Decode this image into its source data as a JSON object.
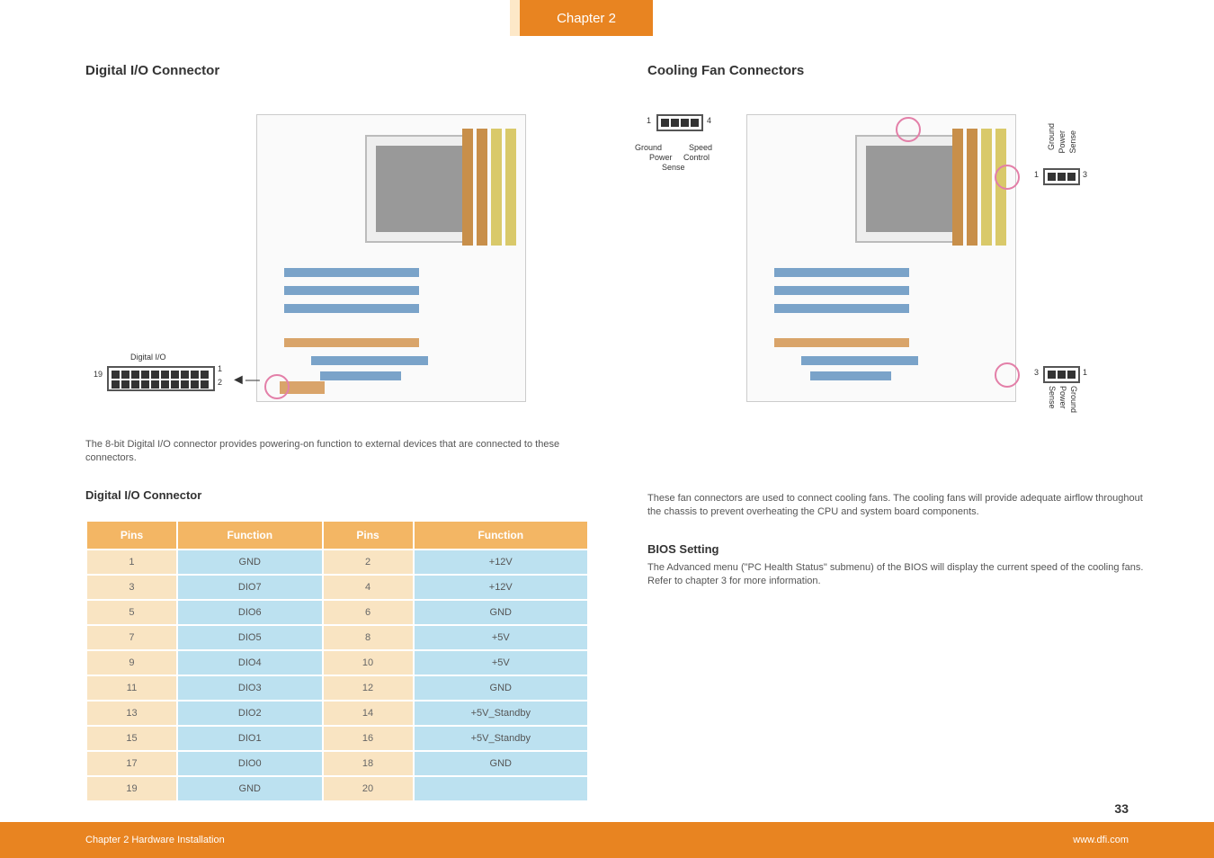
{
  "chapter_tab": "Chapter 2",
  "page_num": "33",
  "footer": {
    "left": "Chapter 2 Hardware Installation",
    "right": "www.dfi.com"
  },
  "left": {
    "heading": "Digital I/O Connector",
    "conn_label": "Digital I/O",
    "pin19": "19",
    "pin1": "1",
    "pin2": "2",
    "desc": "The 8-bit Digital I/O connector provides powering-on function to external devices that are connected to these connectors.",
    "subhead": "Digital I/O Connector",
    "table": {
      "h1": "Pins",
      "h2": "Function",
      "h3": "Pins",
      "h4": "Function",
      "rows": [
        {
          "p1": "1",
          "f1": "GND",
          "p2": "2",
          "f2": "+12V"
        },
        {
          "p1": "3",
          "f1": "DIO7",
          "p2": "4",
          "f2": "+12V"
        },
        {
          "p1": "5",
          "f1": "DIO6",
          "p2": "6",
          "f2": "GND"
        },
        {
          "p1": "7",
          "f1": "DIO5",
          "p2": "8",
          "f2": "+5V"
        },
        {
          "p1": "9",
          "f1": "DIO4",
          "p2": "10",
          "f2": "+5V"
        },
        {
          "p1": "11",
          "f1": "DIO3",
          "p2": "12",
          "f2": "GND"
        },
        {
          "p1": "13",
          "f1": "DIO2",
          "p2": "14",
          "f2": "+5V_Standby"
        },
        {
          "p1": "15",
          "f1": "DIO1",
          "p2": "16",
          "f2": "+5V_Standby"
        },
        {
          "p1": "17",
          "f1": "DIO0",
          "p2": "18",
          "f2": "GND"
        },
        {
          "p1": "19",
          "f1": "GND",
          "p2": "20",
          "f2": ""
        }
      ]
    }
  },
  "right": {
    "heading": "Cooling Fan Connectors",
    "cpu_fan": {
      "p1": "1",
      "p4": "4",
      "labels": [
        "Ground",
        "Power",
        "Sense",
        "Speed",
        "Control"
      ]
    },
    "sys_fan": {
      "p1": "1",
      "p3": "3",
      "labels": [
        "Ground",
        "Power",
        "Sense"
      ]
    },
    "desc": "These fan connectors are used to connect cooling fans. The cooling fans will provide adequate airflow throughout the chassis to prevent overheating the CPU and system board components.",
    "bios_head": "BIOS Setting",
    "bios_desc": "The Advanced menu (\"PC Health Status\" submenu) of the BIOS will display the current speed of the cooling fans. Refer to chapter 3 for more information."
  }
}
